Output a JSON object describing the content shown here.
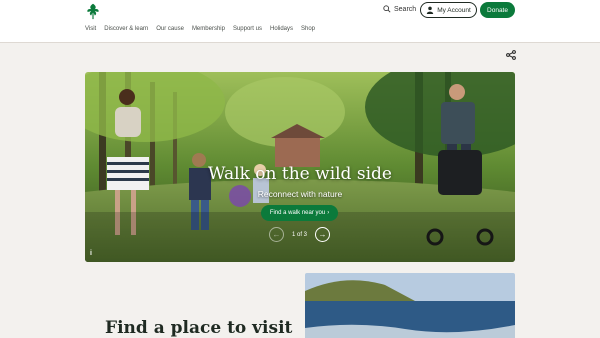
{
  "header": {
    "search_label": "Search",
    "account_label": "My Account",
    "donate_label": "Donate"
  },
  "nav": {
    "items": [
      "Visit",
      "Discover & learn",
      "Our cause",
      "Membership",
      "Support us",
      "Holidays",
      "Shop"
    ]
  },
  "hero": {
    "title": "Walk on the wild side",
    "subtitle": "Reconnect with nature",
    "cta_label": "Find a walk near you",
    "pager_text": "1 of 3",
    "info_label": "i"
  },
  "section": {
    "title": "Find a place to visit"
  },
  "colors": {
    "brand_green": "#0b7a3b",
    "background": "#f3f1ee"
  },
  "icons": {
    "logo": "oak-leaf-logo-icon",
    "search": "search-icon",
    "account": "user-icon",
    "share": "share-icon",
    "prev": "arrow-left-icon",
    "next": "arrow-right-icon",
    "cta": "chevron-right-icon"
  }
}
